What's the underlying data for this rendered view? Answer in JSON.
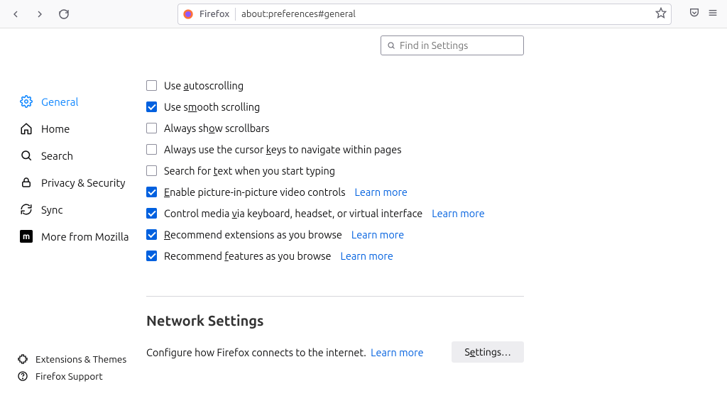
{
  "toolbar": {
    "product": "Firefox",
    "url": "about:preferences#general"
  },
  "sidebar": {
    "items": [
      {
        "label": "General",
        "active": true
      },
      {
        "label": "Home"
      },
      {
        "label": "Search"
      },
      {
        "label": "Privacy & Security"
      },
      {
        "label": "Sync"
      },
      {
        "label": "More from Mozilla"
      }
    ],
    "bottom": [
      {
        "label": "Extensions & Themes"
      },
      {
        "label": "Firefox Support"
      }
    ]
  },
  "search": {
    "placeholder": "Find in Settings"
  },
  "options": [
    {
      "label_pre": "Use ",
      "u": "a",
      "label_post": "utoscrolling",
      "checked": false
    },
    {
      "label_pre": "Use s",
      "u": "m",
      "label_post": "ooth scrolling",
      "checked": true
    },
    {
      "label_pre": "Always sh",
      "u": "o",
      "label_post": "w scrollbars",
      "checked": false
    },
    {
      "label_pre": "Always use the cursor ",
      "u": "k",
      "label_post": "eys to navigate within pages",
      "checked": false
    },
    {
      "label_pre": "Search for ",
      "u": "t",
      "label_post": "ext when you start typing",
      "checked": false
    },
    {
      "label_pre": "",
      "u": "E",
      "label_post": "nable picture-in-picture video controls",
      "checked": true,
      "learn": "Learn more"
    },
    {
      "label_pre": "Control media ",
      "u": "v",
      "label_post": "ia keyboard, headset, or virtual interface",
      "checked": true,
      "learn": "Learn more"
    },
    {
      "label_pre": "",
      "u": "R",
      "label_post": "ecommend extensions as you browse",
      "checked": true,
      "learn": "Learn more"
    },
    {
      "label_pre": "Recommend ",
      "u": "f",
      "label_post": "eatures as you browse",
      "checked": true,
      "learn": "Learn more"
    }
  ],
  "network": {
    "title": "Network Settings",
    "desc": "Configure how Firefox connects to the internet.",
    "learn": "Learn more",
    "button_pre": "S",
    "button_u": "e",
    "button_post": "ttings…"
  }
}
